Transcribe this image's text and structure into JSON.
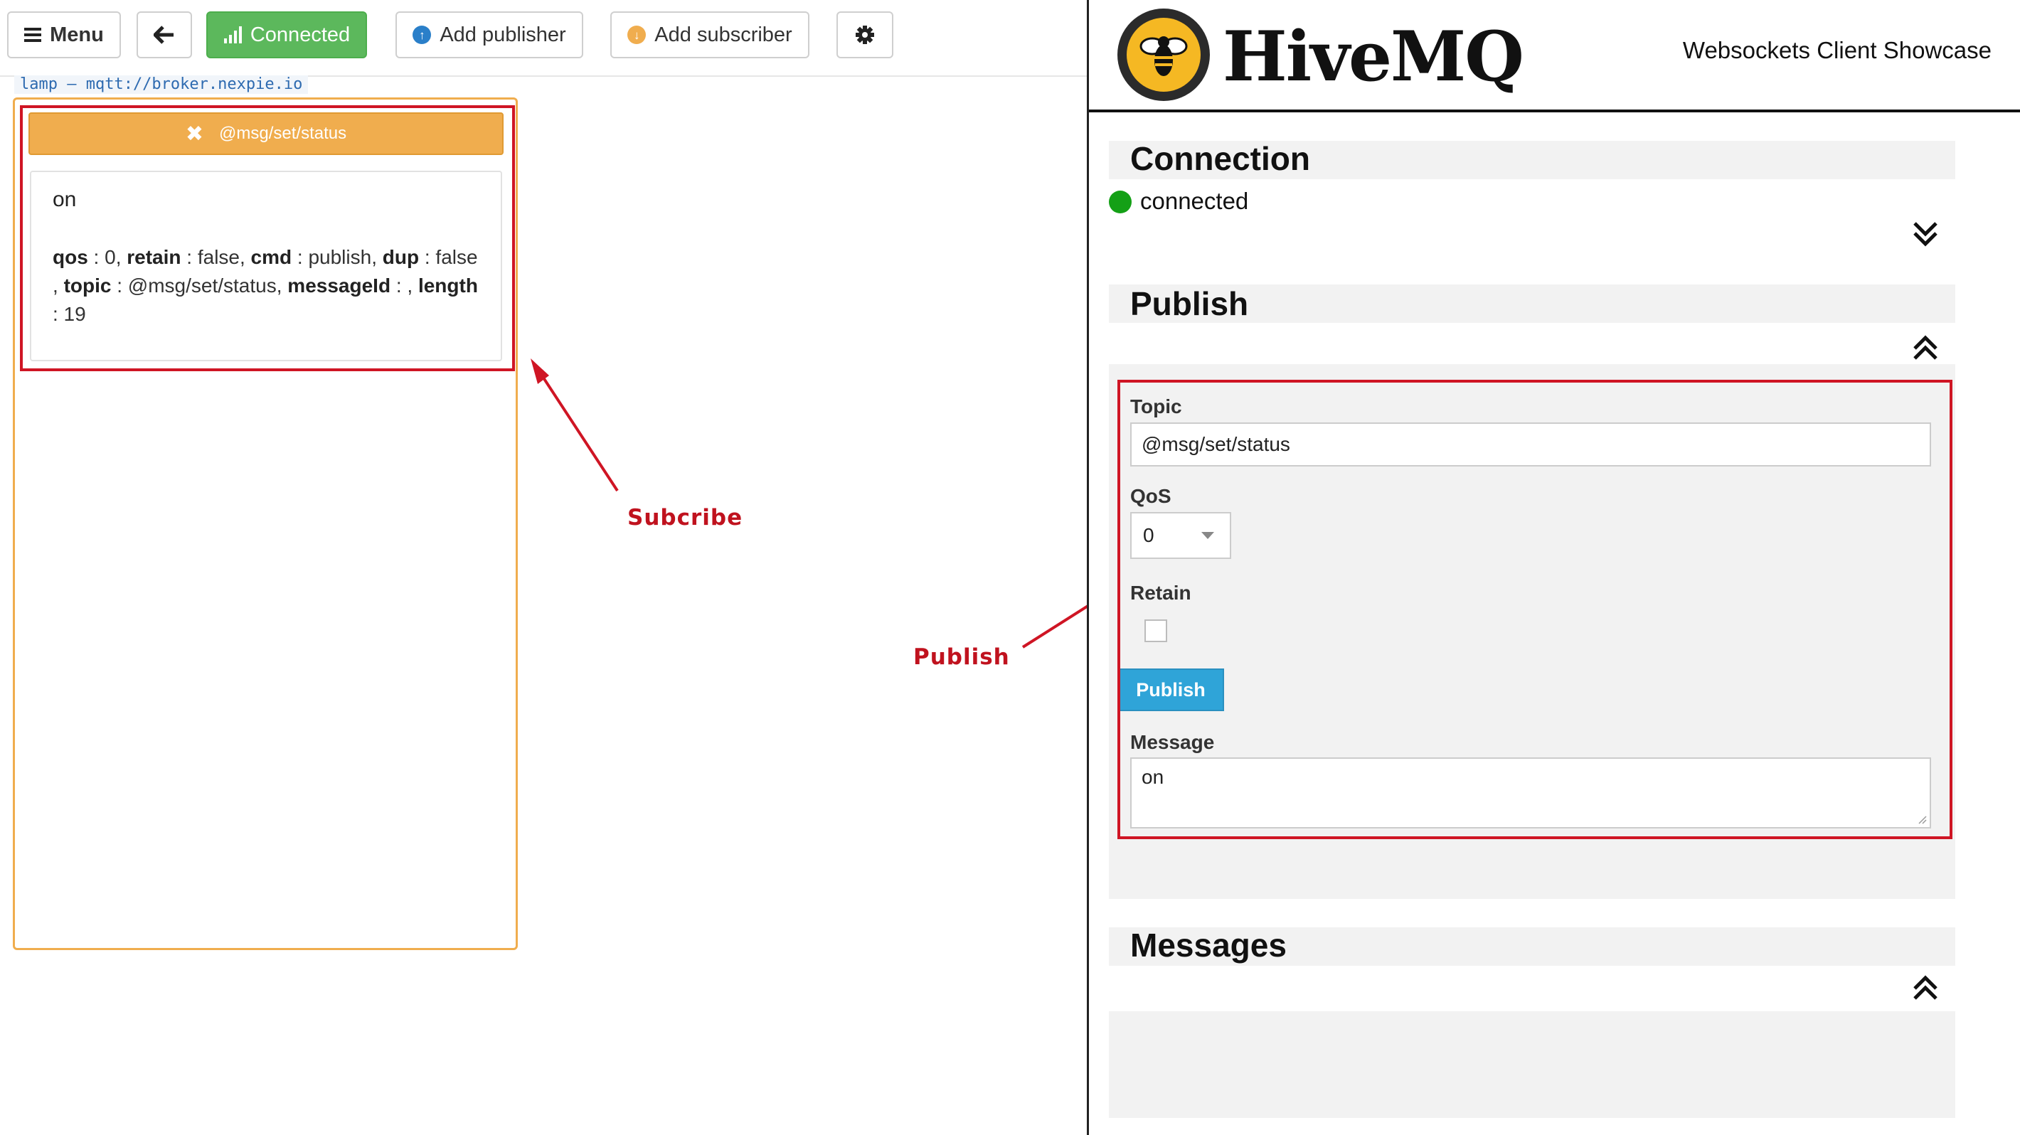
{
  "toolbar": {
    "menu_label": "Menu",
    "connected_label": "Connected",
    "add_publisher_label": "Add publisher",
    "add_subscriber_label": "Add subscriber"
  },
  "connection_label": "lamp – mqtt://broker.nexpie.io",
  "subscriber": {
    "topic": "@msg/set/status",
    "message": {
      "payload": "on",
      "k_qos": "qos",
      "v_qos": " : 0, ",
      "k_retain": "retain",
      "v_retain": " : false, ",
      "k_cmd": "cmd",
      "v_cmd": " : publish, ",
      "k_dup": "dup",
      "v_dup": " : false",
      "sep_topic": ", ",
      "k_topic": "topic",
      "v_topic": " : @msg/set/status, ",
      "k_messageId": "messageId",
      "v_messageId": " : , ",
      "k_length": "length",
      "v_length": " : 19"
    }
  },
  "annotations": {
    "subscribe": "Subcribe",
    "publish": "Publish"
  },
  "hivemq": {
    "logo_text": "HiveMQ",
    "subtitle": "Websockets Client Showcase",
    "connection_title": "Connection",
    "connection_status": "connected",
    "publish_title": "Publish",
    "topic_label": "Topic",
    "topic_value": "@msg/set/status",
    "qos_label": "QoS",
    "qos_value": "0",
    "retain_label": "Retain",
    "publish_button": "Publish",
    "message_label": "Message",
    "message_value": "on",
    "messages_title": "Messages"
  },
  "colors": {
    "connected_green": "#5cb85c",
    "subscriber_orange": "#f0ad4e",
    "annotation_red": "#cf1524",
    "publish_blue": "#2fa4d8",
    "status_green": "#14a016",
    "logo_yellow": "#f5b823"
  },
  "icons": [
    "menu-icon",
    "arrow-left-icon",
    "signal-bars-icon",
    "upload-circle-icon",
    "download-circle-icon",
    "gear-icon",
    "close-icon",
    "bee-logo-icon",
    "chevron-double-down-icon",
    "chevron-double-up-icon",
    "status-dot-icon"
  ]
}
